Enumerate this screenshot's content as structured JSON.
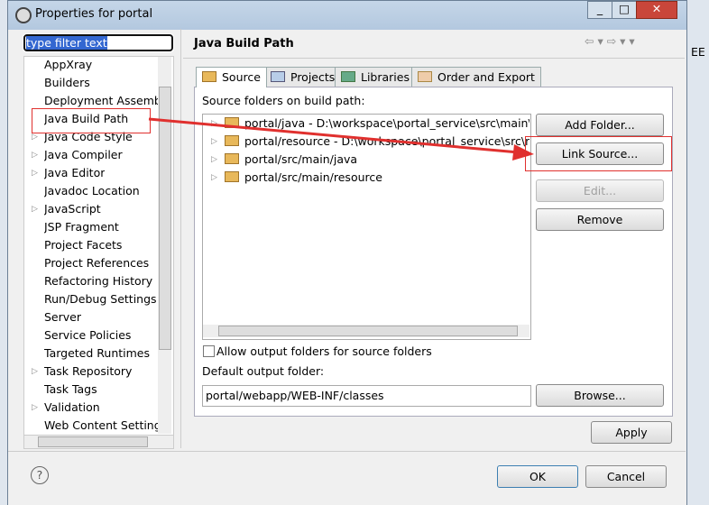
{
  "window": {
    "title": "Properties for portal"
  },
  "filter": {
    "value": "type filter text"
  },
  "tree": [
    {
      "label": "AppXray",
      "expandable": false
    },
    {
      "label": "Builders",
      "expandable": false
    },
    {
      "label": "Deployment Assembly",
      "expandable": false
    },
    {
      "label": "Java Build Path",
      "expandable": false,
      "selected": true
    },
    {
      "label": "Java Code Style",
      "expandable": true
    },
    {
      "label": "Java Compiler",
      "expandable": true
    },
    {
      "label": "Java Editor",
      "expandable": true
    },
    {
      "label": "Javadoc Location",
      "expandable": false
    },
    {
      "label": "JavaScript",
      "expandable": true
    },
    {
      "label": "JSP Fragment",
      "expandable": false
    },
    {
      "label": "Project Facets",
      "expandable": false
    },
    {
      "label": "Project References",
      "expandable": false
    },
    {
      "label": "Refactoring History",
      "expandable": false
    },
    {
      "label": "Run/Debug Settings",
      "expandable": false
    },
    {
      "label": "Server",
      "expandable": false
    },
    {
      "label": "Service Policies",
      "expandable": false
    },
    {
      "label": "Targeted Runtimes",
      "expandable": false
    },
    {
      "label": "Task Repository",
      "expandable": true
    },
    {
      "label": "Task Tags",
      "expandable": false
    },
    {
      "label": "Validation",
      "expandable": true
    },
    {
      "label": "Web Content Settings",
      "expandable": false
    }
  ],
  "page": {
    "title": "Java Build Path"
  },
  "tabs": [
    {
      "label": "Source",
      "active": true
    },
    {
      "label": "Projects"
    },
    {
      "label": "Libraries"
    },
    {
      "label": "Order and Export"
    }
  ],
  "source": {
    "list_label": "Source folders on build path:",
    "folders": [
      "portal/java - D:\\workspace\\portal_service\\src\\main\\java",
      "portal/resource - D:\\workspace\\portal_service\\src\\main\\resource",
      "portal/src/main/java",
      "portal/src/main/resource"
    ],
    "buttons": {
      "add_folder": "Add Folder...",
      "link_source": "Link Source...",
      "edit": "Edit...",
      "remove": "Remove",
      "browse": "Browse..."
    },
    "allow_output_label": "Allow output folders for source folders",
    "allow_output_checked": false,
    "default_output_label": "Default output folder:",
    "default_output_value": "portal/webapp/WEB-INF/classes"
  },
  "apply": "Apply",
  "ok": "OK",
  "cancel": "Cancel",
  "background": {
    "ee": "EE"
  },
  "annotation_color": "#e0302e"
}
